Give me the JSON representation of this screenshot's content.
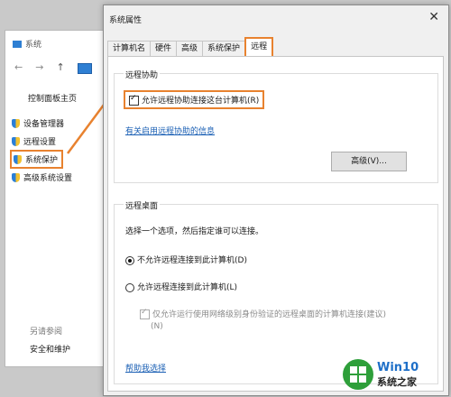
{
  "background_window": {
    "title": "系统",
    "nav_up": "↑",
    "control_panel_home": "控制面板主页",
    "items": [
      {
        "label": "设备管理器"
      },
      {
        "label": "远程设置"
      },
      {
        "label": "系统保护"
      },
      {
        "label": "高级系统设置"
      }
    ],
    "see_also": "另请参阅",
    "security_maintenance": "安全和维护"
  },
  "dialog": {
    "title": "系统属性",
    "close": "✕",
    "tabs": [
      "计算机名",
      "硬件",
      "高级",
      "系统保护",
      "远程"
    ],
    "active_tab": "远程",
    "remote_assistance": {
      "group_label": "远程协助",
      "allow_checkbox": "允许远程协助连接这台计算机(R)",
      "allow_checked": true,
      "info_link": "有关启用远程协助的信息",
      "advanced_button": "高级(V)..."
    },
    "remote_desktop": {
      "group_label": "远程桌面",
      "instruction": "选择一个选项，然后指定谁可以连接。",
      "options": [
        {
          "label": "不允许远程连接到此计算机(D)",
          "selected": true
        },
        {
          "label": "允许远程连接到此计算机(L)",
          "selected": false
        }
      ],
      "nla_checkbox_line1": "仅允许运行使用网络级别身份验证的远程桌面的计算机连接(建议)",
      "nla_checkbox_line2": "(N)",
      "nla_checked": true,
      "help_link": "帮助我选择"
    }
  },
  "watermark": {
    "brand": "Win10",
    "sub": "系统之家"
  },
  "colors": {
    "highlight": "#e8822f",
    "link": "#1a5fb4"
  }
}
